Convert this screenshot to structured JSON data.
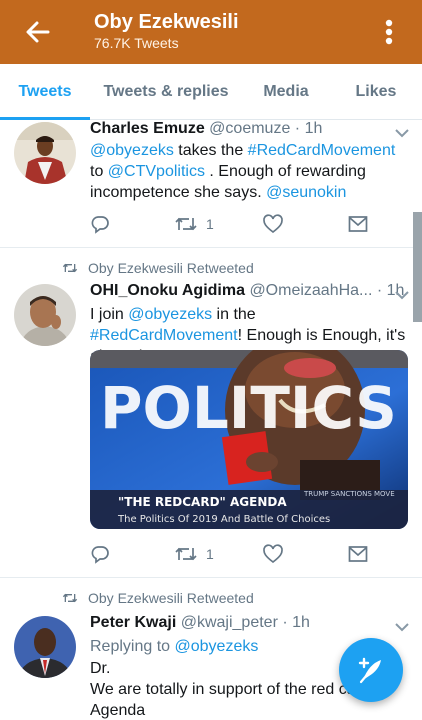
{
  "header": {
    "title": "Oby Ezekwesili",
    "subtitle": "76.7K Tweets",
    "back_icon": "arrow-left-icon",
    "more_icon": "vertical-dots-icon",
    "bg_color": "#c2691e"
  },
  "tabs": [
    {
      "label": "Tweets",
      "active": true
    },
    {
      "label": "Tweets & replies",
      "active": false
    },
    {
      "label": "Media",
      "active": false
    },
    {
      "label": "Likes",
      "active": false
    }
  ],
  "tweets": [
    {
      "name": "Charles Emuze",
      "handle": "@coemuze",
      "time": "· 1h",
      "text": {
        "mention1": "@obyezeks",
        "t1": " takes the ",
        "hashtag": "#RedCardMovement",
        "t2": " to ",
        "mention2": "@CTVpolitics",
        "t3": " . Enough of rewarding incompetence she says. ",
        "mention3": "@seunokin"
      },
      "retweets": "1"
    },
    {
      "retweeted_by": "Oby Ezekwesili Retweeted",
      "name": "OHI_Onoku Agidima",
      "handle": "@OmeizaahHa...",
      "time": "· 1h",
      "text": {
        "t1": "I join ",
        "mention1": "@obyezeks",
        "t2": " in the ",
        "hashtag": "#RedCardMovement",
        "t3": "! Enough is Enough, it's about time.."
      },
      "media": {
        "big_text": "POLITICS",
        "banner_title": "\"THE REDCARD\" AGENDA",
        "banner_sub": "The Politics Of 2019 And Battle Of Choices",
        "ticker": "TRUMP SANCTIONS MOVE"
      },
      "retweets": "1"
    },
    {
      "retweeted_by": "Oby Ezekwesili Retweeted",
      "name": "Peter Kwaji",
      "handle": "@kwaji_peter",
      "time": "· 1h",
      "replying_label": "Replying to ",
      "replying_to": "@obyezeks",
      "lines": [
        "Dr.",
        "We are totally in support of the red ca",
        "Agenda"
      ]
    }
  ],
  "accent_color": "#1da1f2",
  "compose_icon": "feather-plus-icon"
}
